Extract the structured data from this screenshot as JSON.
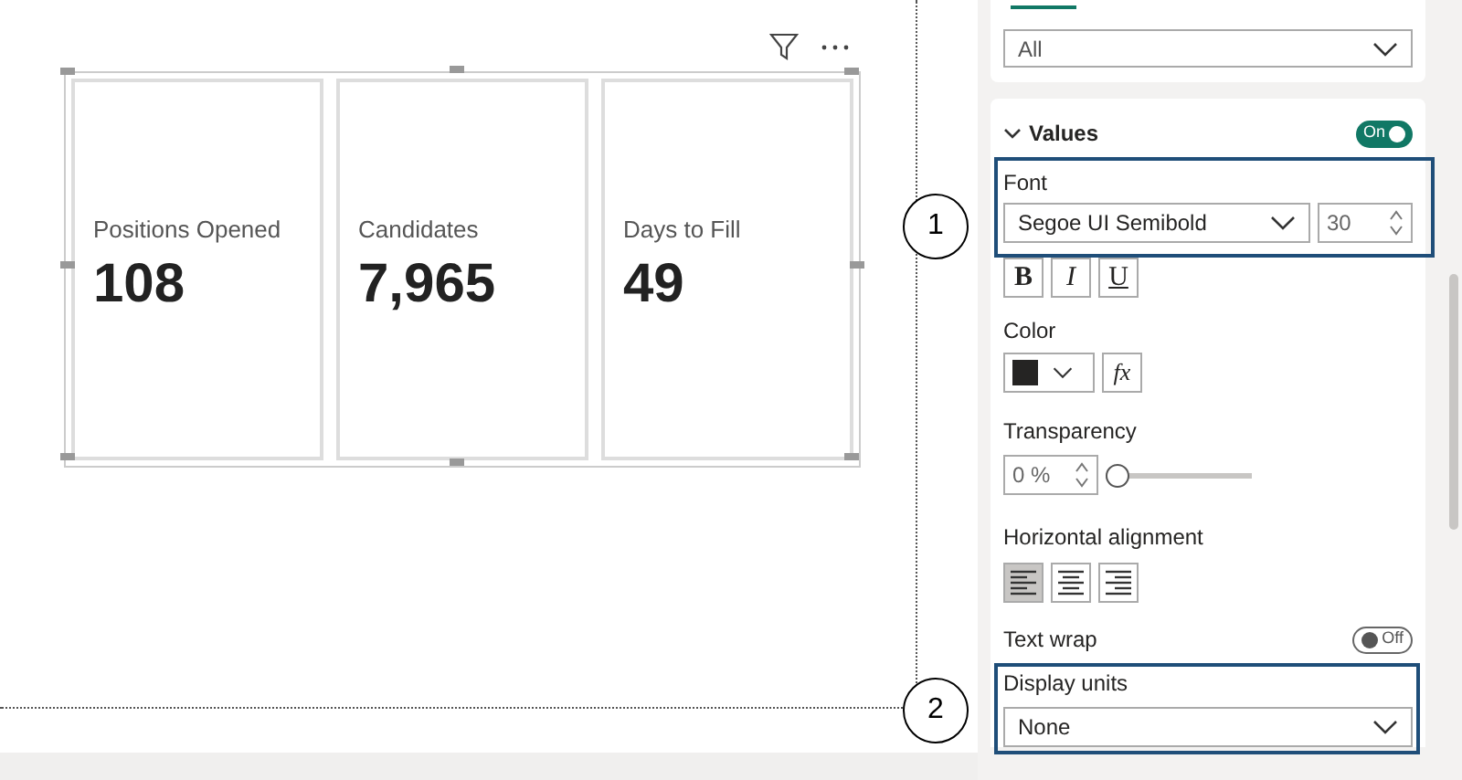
{
  "cards": [
    {
      "label": "Positions Opened",
      "value": "108"
    },
    {
      "label": "Candidates",
      "value": "7,965"
    },
    {
      "label": "Days to Fill",
      "value": "49"
    }
  ],
  "panel": {
    "top_dropdown": {
      "value": "All"
    },
    "values_section": {
      "title": "Values",
      "expanded": true,
      "on": true,
      "toggle_label": "On",
      "font_label": "Font",
      "font_family": "Segoe UI Semibold",
      "font_size": "30",
      "styles": [
        {
          "label": "B",
          "kind": "bold",
          "selected": false
        },
        {
          "label": "I",
          "kind": "italic",
          "selected": false
        },
        {
          "label": "U",
          "kind": "underline",
          "selected": false
        }
      ],
      "color_label": "Color",
      "fx_label": "fx",
      "transparency_label": "Transparency",
      "transparency_value": "0 %",
      "level": 0,
      "alignment_label": "Horizontal alignment",
      "alignments": [
        {
          "kind": "left",
          "selected": true
        },
        {
          "kind": "center",
          "selected": false
        },
        {
          "kind": "right",
          "selected": false
        }
      ],
      "text_wrap_label": "Text wrap",
      "text_wrap_on": false,
      "text_wrap_toggle_label": "Off",
      "display_units_label": "Display units",
      "display_units_value": "None"
    }
  },
  "callouts": [
    {
      "number": "1"
    },
    {
      "number": "2"
    }
  ]
}
